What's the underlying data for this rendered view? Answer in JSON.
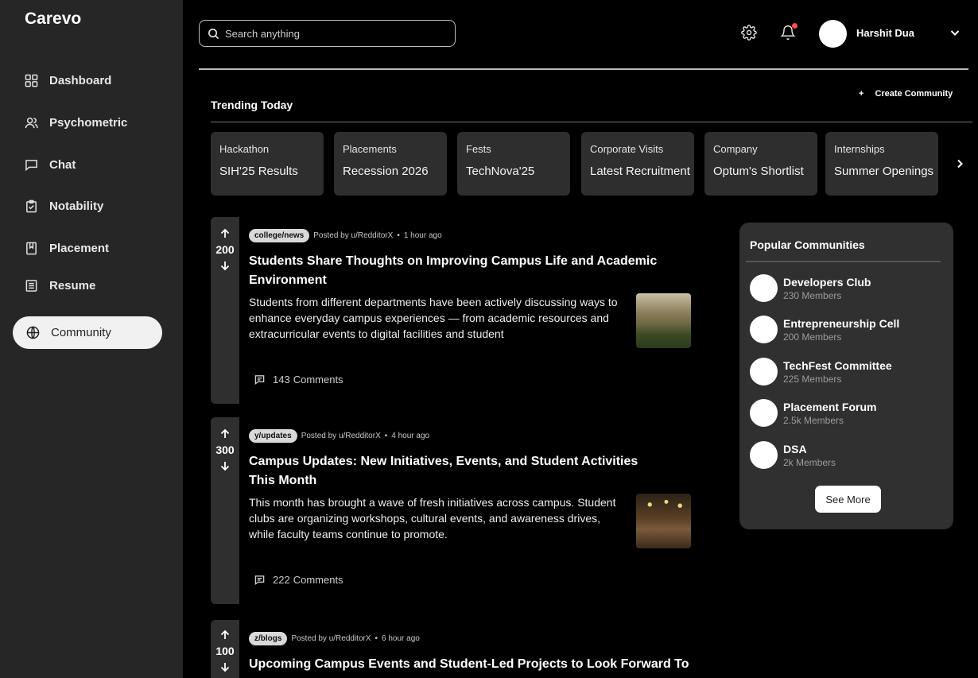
{
  "app": {
    "logo": "Carevo"
  },
  "sidebar": {
    "items": [
      {
        "label": "Dashboard",
        "icon": "dashboard-icon"
      },
      {
        "label": "Psychometric",
        "icon": "users-icon"
      },
      {
        "label": "Chat",
        "icon": "chat-icon"
      },
      {
        "label": "Notability",
        "icon": "clipboard-icon"
      },
      {
        "label": "Placement",
        "icon": "bookmark-icon"
      },
      {
        "label": "Resume",
        "icon": "document-icon"
      },
      {
        "label": "Community",
        "icon": "globe-icon",
        "active": true
      }
    ]
  },
  "header": {
    "search_placeholder": "Search anything",
    "username": "Harshit Dua",
    "notification_dot_color": "#ff4d4d"
  },
  "trending": {
    "title": "Trending Today",
    "create_label": "Create Community",
    "create_icon": "+",
    "cards": [
      {
        "category": "Hackathon",
        "name": "SIH'25 Results"
      },
      {
        "category": "Placements",
        "name": "Recession 2026"
      },
      {
        "category": "Fests",
        "name": "TechNova'25"
      },
      {
        "category": "Corporate Visits",
        "name": "Latest Recruitment"
      },
      {
        "category": "Company",
        "name": "Optum's Shortlist"
      },
      {
        "category": "Internships",
        "name": "Summer Openings"
      }
    ]
  },
  "posts": [
    {
      "votes": "200",
      "tag": "college/news",
      "posted_by": "Posted by u/RedditorX",
      "time": "1 hour ago",
      "title": "Students Share Thoughts on Improving Campus Life and Academic Environment",
      "description": "Students from different departments have been actively discussing ways to enhance everyday campus experiences — from academic resources and extracurricular events to digital facilities and student",
      "comments_count": "143",
      "comments_label": "Comments"
    },
    {
      "votes": "300",
      "tag": "y/updates",
      "posted_by": "Posted by u/RedditorX",
      "time": "4 hour ago",
      "title": "Campus Updates: New Initiatives, Events, and Student Activities This Month",
      "description": "This month has brought a wave of fresh initiatives across campus. Student clubs are organizing workshops, cultural events, and awareness drives, while faculty teams continue to promote.",
      "comments_count": "222",
      "comments_label": "Comments"
    },
    {
      "votes": "100",
      "tag": "z/blogs",
      "posted_by": "Posted by u/RedditorX",
      "time": "6 hour ago",
      "title": "Upcoming Campus Events and Student-Led Projects to Look Forward To"
    }
  ],
  "popular": {
    "title": "Popular Communities",
    "communities": [
      {
        "name": "Developers Club",
        "members": "230 Members"
      },
      {
        "name": "Entrepreneurship Cell",
        "members": "200 Members"
      },
      {
        "name": "TechFest Committee",
        "members": "225 Members"
      },
      {
        "name": "Placement Forum",
        "members": "2.5k Members"
      },
      {
        "name": "DSA",
        "members": "2k Members"
      }
    ],
    "see_more": "See More"
  }
}
